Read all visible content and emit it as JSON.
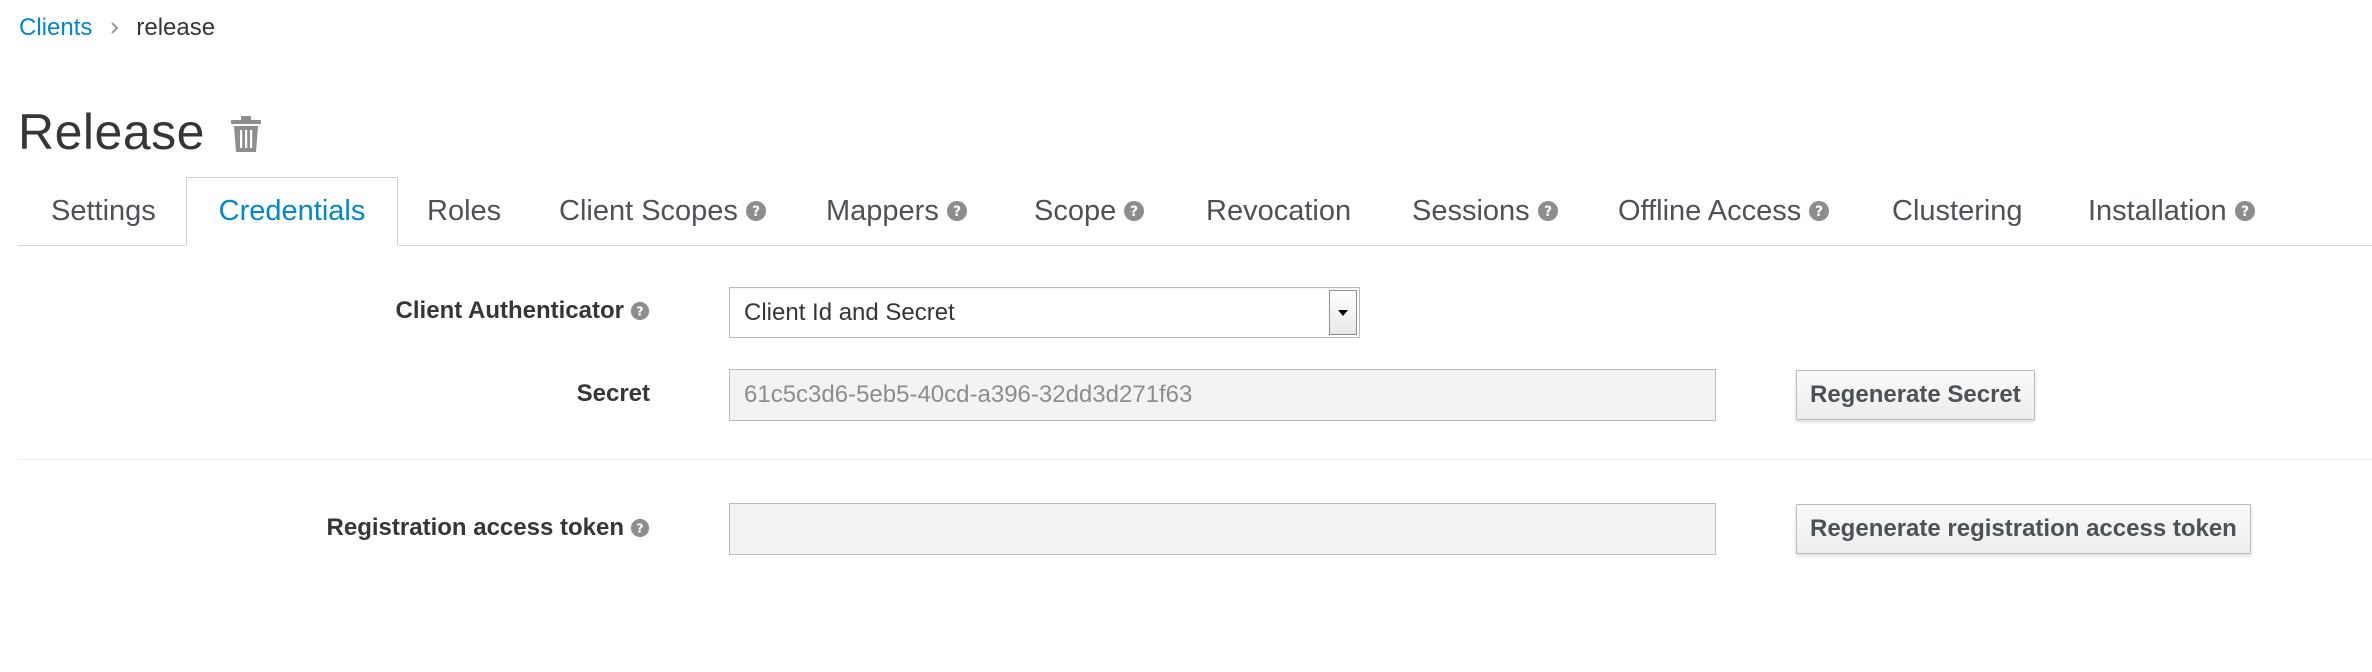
{
  "breadcrumb": {
    "parent": "Clients",
    "current": "release"
  },
  "page": {
    "title": "Release"
  },
  "tabs": [
    {
      "label": "Settings",
      "active": false,
      "help": false
    },
    {
      "label": "Credentials",
      "active": true,
      "help": false
    },
    {
      "label": "Roles",
      "active": false,
      "help": false
    },
    {
      "label": "Client Scopes",
      "active": false,
      "help": true
    },
    {
      "label": "Mappers",
      "active": false,
      "help": true
    },
    {
      "label": "Scope",
      "active": false,
      "help": true
    },
    {
      "label": "Revocation",
      "active": false,
      "help": false
    },
    {
      "label": "Sessions",
      "active": false,
      "help": true
    },
    {
      "label": "Offline Access",
      "active": false,
      "help": true
    },
    {
      "label": "Clustering",
      "active": false,
      "help": false
    },
    {
      "label": "Installation",
      "active": false,
      "help": true
    }
  ],
  "form": {
    "client_authenticator": {
      "label": "Client Authenticator",
      "value": "Client Id and Secret"
    },
    "secret": {
      "label": "Secret",
      "value": "61c5c3d6-5eb5-40cd-a396-32dd3d271f63",
      "button": "Regenerate Secret"
    },
    "registration_token": {
      "label": "Registration access token",
      "value": "",
      "button": "Regenerate registration access token"
    }
  },
  "colors": {
    "link": "#0088ce",
    "text": "#363636",
    "border": "#d1d1d1",
    "input_bg": "#f3f3f3",
    "help_icon": "#8b8d8f"
  },
  "icons": {
    "delete": "trash-icon",
    "help": "question-circle-icon",
    "breadcrumb_separator": "chevron-right-icon",
    "dropdown": "caret-down-icon"
  }
}
